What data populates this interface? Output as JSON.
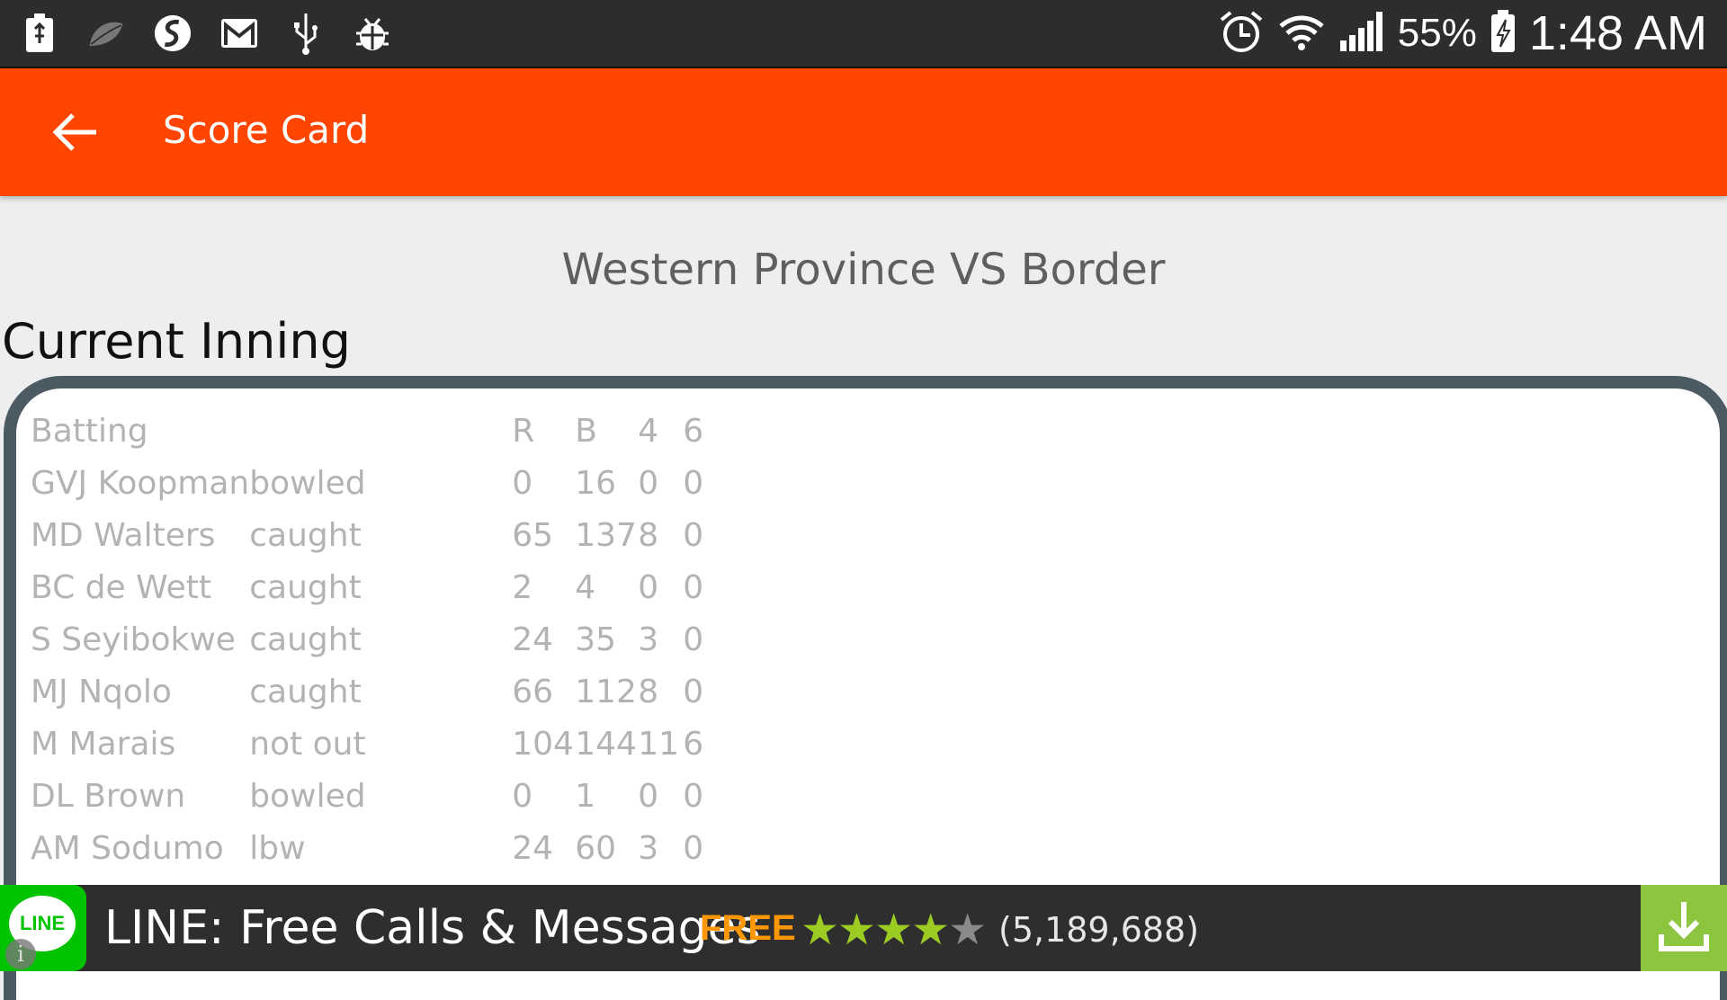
{
  "status_bar": {
    "left_icons": [
      "usb-battery-icon",
      "leaf-icon",
      "swype-icon",
      "gmail-icon",
      "usb-icon",
      "debug-bug-icon"
    ],
    "right_icons": [
      "alarm-icon",
      "wifi-icon",
      "signal-icon",
      "battery-charging-icon"
    ],
    "battery_percent": "55%",
    "time": "1:48 AM"
  },
  "app_bar": {
    "title": "Score Card",
    "color": "#ff4500",
    "back_icon": "arrow-left-icon"
  },
  "match": {
    "title": "Western Province VS Border"
  },
  "inning": {
    "section_title": "Current Inning",
    "headers": {
      "batting": "Batting",
      "dismissal": "",
      "runs": "R",
      "balls": "B",
      "fours": "4",
      "sixes": "6"
    },
    "rows": [
      {
        "name": "GVJ Koopman",
        "dismissal": "bowled",
        "r": "0",
        "b": "16",
        "fours": "0",
        "sixes": "0"
      },
      {
        "name": "MD Walters",
        "dismissal": "caught",
        "r": "65",
        "b": "137",
        "fours": "8",
        "sixes": "0"
      },
      {
        "name": "BC de Wett",
        "dismissal": "caught",
        "r": "2",
        "b": "4",
        "fours": "0",
        "sixes": "0"
      },
      {
        "name": "S Seyibokwe",
        "dismissal": "caught",
        "r": "24",
        "b": "35",
        "fours": "3",
        "sixes": "0"
      },
      {
        "name": "MJ Nqolo",
        "dismissal": "caught",
        "r": "66",
        "b": "112",
        "fours": "8",
        "sixes": "0"
      },
      {
        "name": "M Marais",
        "dismissal": "not out",
        "r": "104",
        "b": "144",
        "fours": "11",
        "sixes": "6"
      },
      {
        "name": "DL Brown",
        "dismissal": "bowled",
        "r": "0",
        "b": "1",
        "fours": "0",
        "sixes": "0"
      },
      {
        "name": "AM Sodumo",
        "dismissal": "lbw",
        "r": "24",
        "b": "60",
        "fours": "3",
        "sixes": "0"
      }
    ]
  },
  "ad": {
    "logo_text": "LINE",
    "info_icon": "info-icon",
    "title": "LINE: Free Calls & Messages",
    "price": "FREE",
    "rating_stars": 4,
    "rating_max": 5,
    "review_count": "(5,189,688)",
    "download_icon": "download-icon",
    "colors": {
      "price": "#ff9800",
      "stars": "#9ccc23",
      "download_bg": "#8cc63f",
      "logo_bg": "#00c300"
    }
  }
}
